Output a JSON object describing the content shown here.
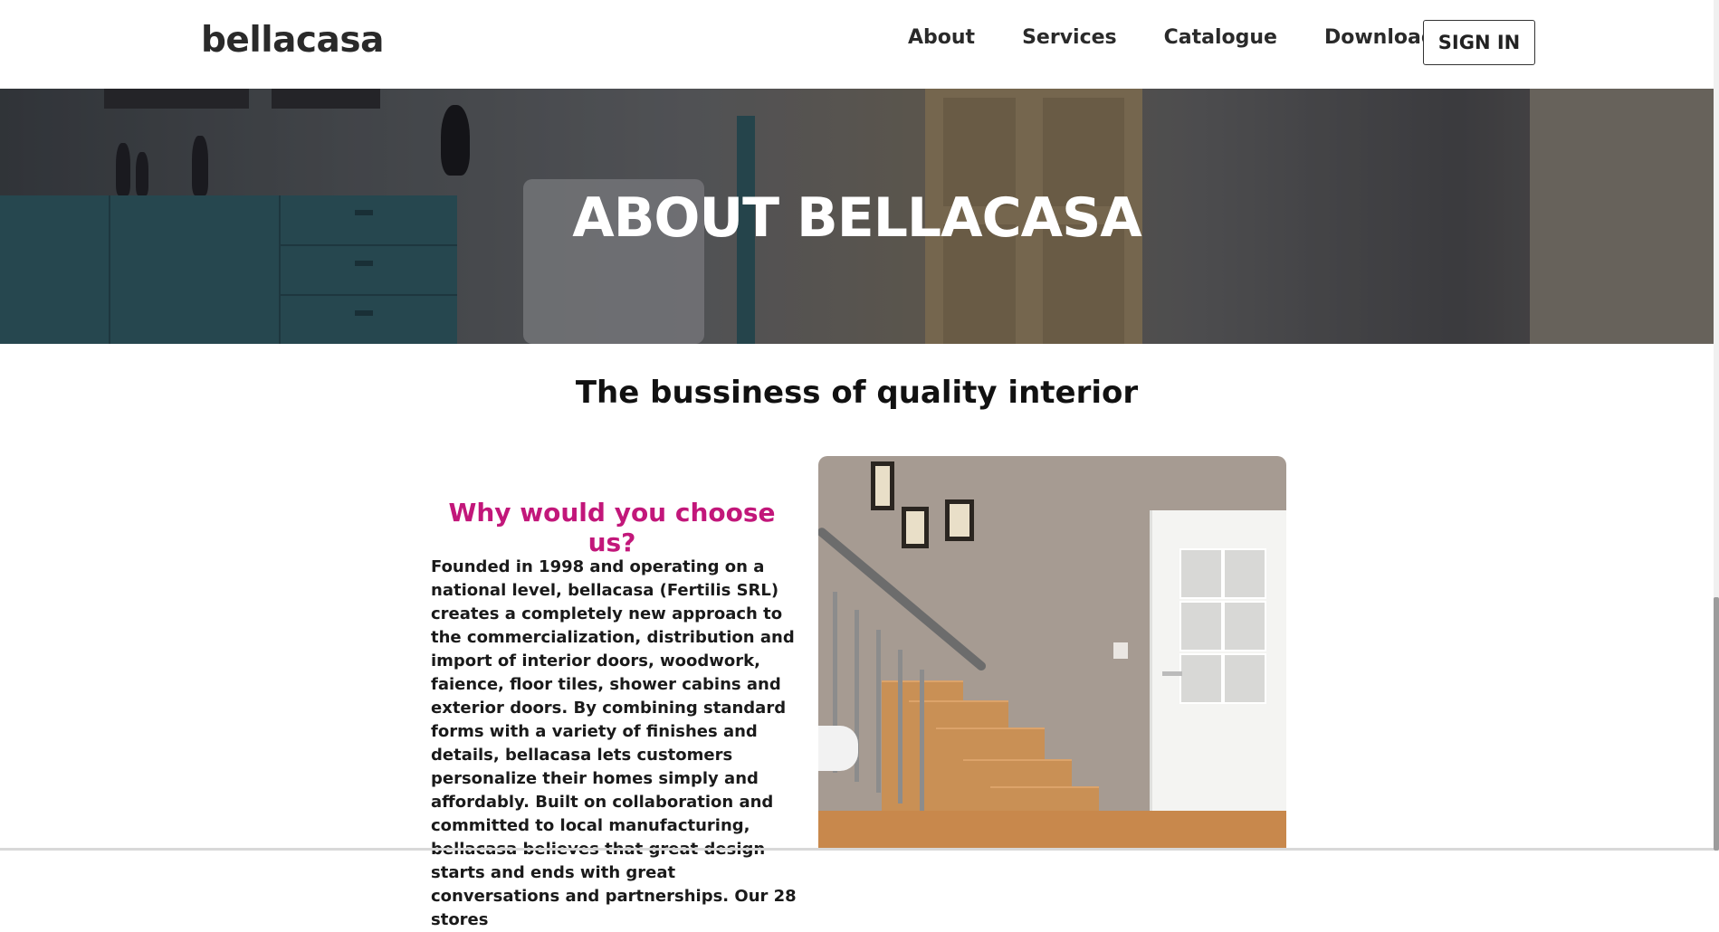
{
  "header": {
    "logo": "bellacasa",
    "nav": [
      "About",
      "Services",
      "Catalogue",
      "Download"
    ],
    "signin_label": "SIGN IN"
  },
  "hero": {
    "title": "ABOUT BELLACASA"
  },
  "main": {
    "subtitle": "The bussiness of quality interior",
    "why_title": "Why would you choose us?",
    "body": "Founded in 1998 and operating on a national level, bellacasa (Fertilis SRL) creates a completely new approach to the commercialization, distribution and import of interior doors, woodwork, faience, floor tiles, shower cabins and exterior doors. By combining standard forms with a variety of finishes and details, bellacasa lets customers personalize their homes simply and affordably. Built on collaboration and committed to local manufacturing, bellacasa believes that great design starts and ends with great conversations and partnerships. Our 28 stores"
  },
  "colors": {
    "accent": "#c2177a",
    "text": "#111111",
    "header_bg": "#ffffff"
  }
}
